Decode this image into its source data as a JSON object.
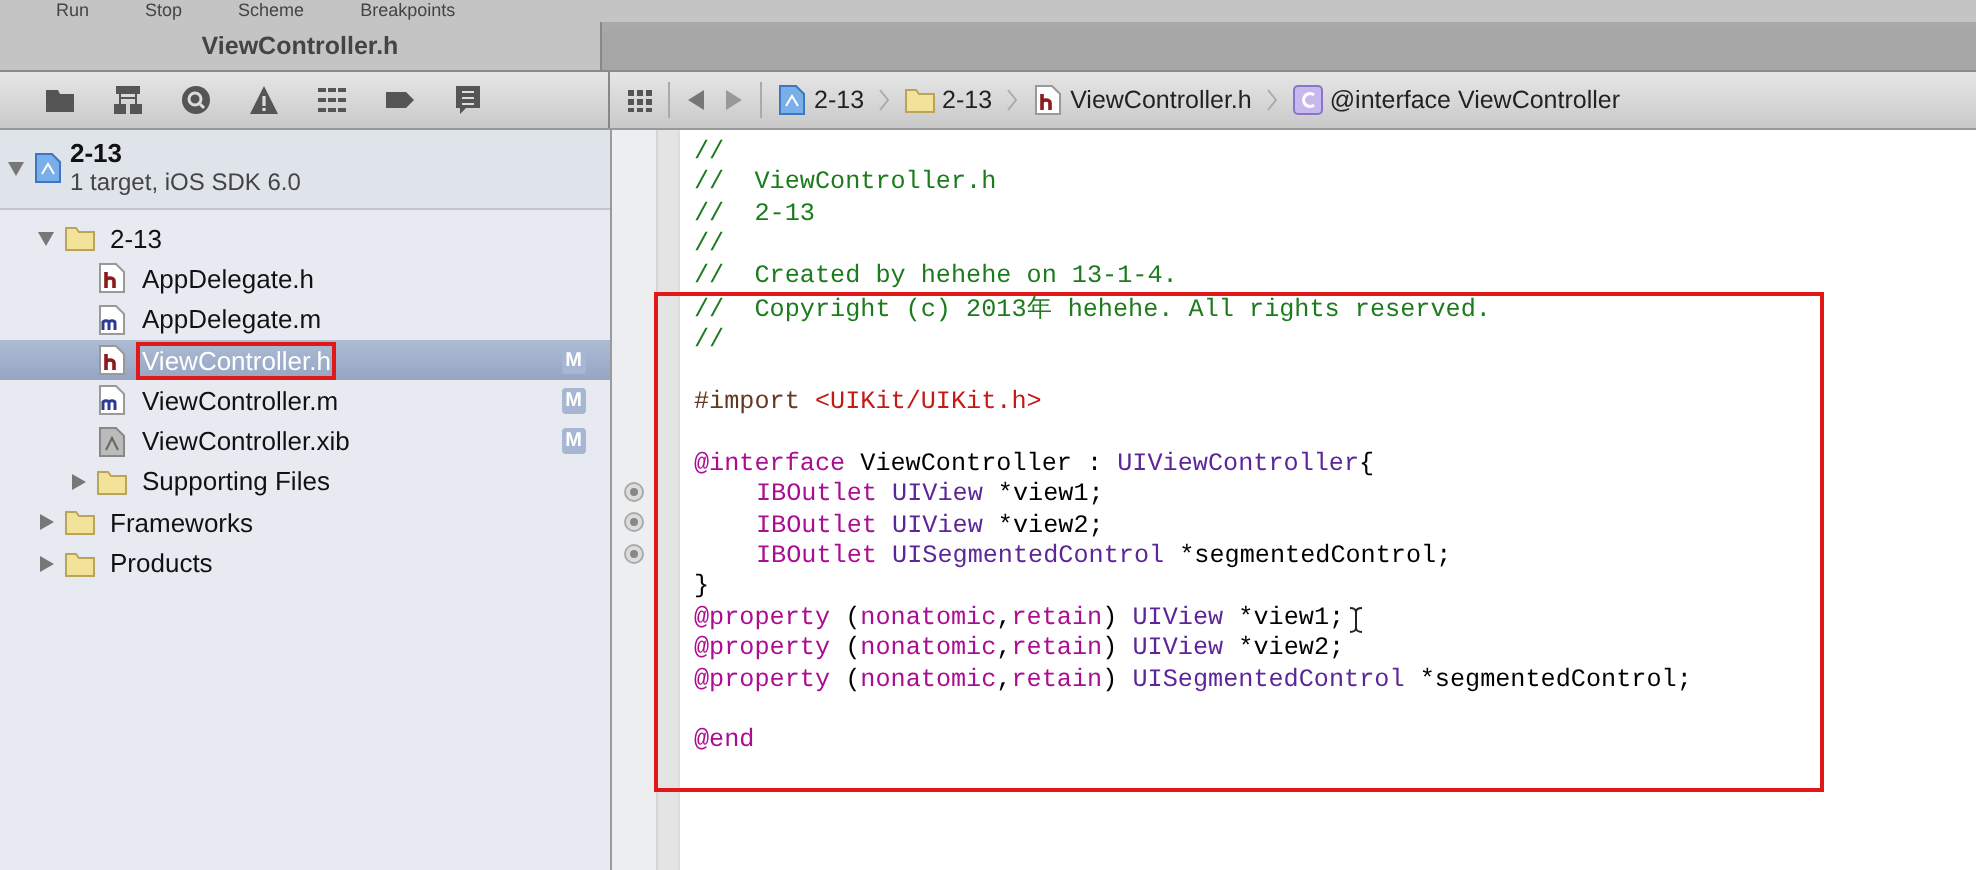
{
  "toolbar": {
    "labels": [
      "Run",
      "Stop",
      "Scheme",
      "Breakpoints"
    ]
  },
  "tabs": [
    {
      "label": "ViewController.h",
      "selected": true
    }
  ],
  "jump_bar": [
    {
      "kind": "project",
      "label": "2-13"
    },
    {
      "kind": "folder",
      "label": "2-13"
    },
    {
      "kind": "header",
      "label": "ViewController.h"
    },
    {
      "kind": "class",
      "label": "@interface ViewController"
    }
  ],
  "project": {
    "name": "2-13",
    "subtitle": "1 target, iOS SDK 6.0",
    "expanded": true,
    "children": [
      {
        "kind": "folder",
        "name": "2-13",
        "expanded": true,
        "selected": false,
        "annotated": false,
        "children": [
          {
            "kind": "header",
            "name": "AppDelegate.h",
            "selected": false,
            "annotated": false
          },
          {
            "kind": "source",
            "name": "AppDelegate.m",
            "selected": false,
            "annotated": false
          },
          {
            "kind": "header",
            "name": "ViewController.h",
            "selected": true,
            "annotated": true,
            "badge": "M"
          },
          {
            "kind": "source",
            "name": "ViewController.m",
            "selected": false,
            "annotated": false,
            "badge": "M"
          },
          {
            "kind": "xib",
            "name": "ViewController.xib",
            "selected": false,
            "annotated": false,
            "badge": "M"
          },
          {
            "kind": "folder",
            "name": "Supporting Files",
            "expanded": false,
            "selected": false,
            "annotated": false
          }
        ]
      },
      {
        "kind": "folder",
        "name": "Frameworks",
        "expanded": false,
        "selected": false,
        "annotated": false
      },
      {
        "kind": "folder",
        "name": "Products",
        "expanded": false,
        "selected": false,
        "annotated": false
      }
    ]
  },
  "code": {
    "lines": [
      {
        "boxed": false,
        "outlet": false,
        "cursor": false,
        "indented": false,
        "tokens": [
          {
            "kind": "comment",
            "text": "//"
          }
        ]
      },
      {
        "boxed": false,
        "outlet": false,
        "cursor": false,
        "indented": false,
        "tokens": [
          {
            "kind": "comment",
            "text": "//  ViewController.h"
          }
        ]
      },
      {
        "boxed": false,
        "outlet": false,
        "cursor": false,
        "indented": false,
        "tokens": [
          {
            "kind": "comment",
            "text": "//  2-13"
          }
        ]
      },
      {
        "boxed": false,
        "outlet": false,
        "cursor": false,
        "indented": false,
        "tokens": [
          {
            "kind": "comment",
            "text": "//"
          }
        ]
      },
      {
        "boxed": false,
        "outlet": false,
        "cursor": false,
        "indented": false,
        "tokens": [
          {
            "kind": "comment",
            "text": "//  Created by hehehe on 13-1-4."
          }
        ]
      },
      {
        "boxed": true,
        "outlet": false,
        "cursor": false,
        "indented": false,
        "tokens": [
          {
            "kind": "comment",
            "text": "//  Copyright (c) 2013年 hehehe. All rights reserved."
          }
        ]
      },
      {
        "boxed": true,
        "outlet": false,
        "cursor": false,
        "indented": false,
        "tokens": [
          {
            "kind": "comment",
            "text": "//"
          }
        ]
      },
      {
        "boxed": true,
        "outlet": false,
        "cursor": false,
        "indented": false
      },
      {
        "boxed": true,
        "outlet": false,
        "cursor": false,
        "indented": false,
        "tokens": [
          {
            "kind": "directive",
            "text": "#import "
          },
          {
            "kind": "string",
            "text": "<UIKit/UIKit.h>"
          }
        ]
      },
      {
        "boxed": true,
        "outlet": false,
        "cursor": false,
        "indented": false
      },
      {
        "boxed": true,
        "outlet": false,
        "cursor": false,
        "indented": false,
        "tokens": [
          {
            "kind": "keyword",
            "text": "@interface"
          },
          {
            "kind": "plain",
            "text": " ViewController : "
          },
          {
            "kind": "type",
            "text": "UIViewController"
          },
          {
            "kind": "plain",
            "text": "{"
          }
        ]
      },
      {
        "boxed": true,
        "outlet": true,
        "cursor": false,
        "indented": true,
        "tokens": [
          {
            "kind": "keyword",
            "text": "IBOutlet"
          },
          {
            "kind": "type",
            "text": " UIView"
          },
          {
            "kind": "plain",
            "text": " *view1;"
          }
        ]
      },
      {
        "boxed": true,
        "outlet": true,
        "cursor": false,
        "indented": true,
        "tokens": [
          {
            "kind": "keyword",
            "text": "IBOutlet"
          },
          {
            "kind": "type",
            "text": " UIView"
          },
          {
            "kind": "plain",
            "text": " *view2;"
          }
        ]
      },
      {
        "boxed": true,
        "outlet": true,
        "cursor": false,
        "indented": true,
        "tokens": [
          {
            "kind": "keyword",
            "text": "IBOutlet"
          },
          {
            "kind": "type",
            "text": " UISegmentedControl"
          },
          {
            "kind": "plain",
            "text": " *segmentedControl;"
          }
        ]
      },
      {
        "boxed": true,
        "outlet": false,
        "cursor": false,
        "indented": false,
        "tokens": [
          {
            "kind": "plain",
            "text": "}"
          }
        ]
      },
      {
        "boxed": true,
        "outlet": false,
        "cursor": true,
        "indented": false,
        "tokens": [
          {
            "kind": "keyword",
            "text": "@property"
          },
          {
            "kind": "plain",
            "text": " ("
          },
          {
            "kind": "keyword",
            "text": "nonatomic"
          },
          {
            "kind": "plain",
            "text": ","
          },
          {
            "kind": "keyword",
            "text": "retain"
          },
          {
            "kind": "plain",
            "text": ") "
          },
          {
            "kind": "type",
            "text": "UIView"
          },
          {
            "kind": "plain",
            "text": " *view1;"
          }
        ]
      },
      {
        "boxed": true,
        "outlet": false,
        "cursor": false,
        "indented": false,
        "tokens": [
          {
            "kind": "keyword",
            "text": "@property"
          },
          {
            "kind": "plain",
            "text": " ("
          },
          {
            "kind": "keyword",
            "text": "nonatomic"
          },
          {
            "kind": "plain",
            "text": ","
          },
          {
            "kind": "keyword",
            "text": "retain"
          },
          {
            "kind": "plain",
            "text": ") "
          },
          {
            "kind": "type",
            "text": "UIView"
          },
          {
            "kind": "plain",
            "text": " *view2;"
          }
        ]
      },
      {
        "boxed": true,
        "outlet": false,
        "cursor": false,
        "indented": false,
        "tokens": [
          {
            "kind": "keyword",
            "text": "@property"
          },
          {
            "kind": "plain",
            "text": " ("
          },
          {
            "kind": "keyword",
            "text": "nonatomic"
          },
          {
            "kind": "plain",
            "text": ","
          },
          {
            "kind": "keyword",
            "text": "retain"
          },
          {
            "kind": "plain",
            "text": ") "
          },
          {
            "kind": "type",
            "text": "UISegmentedControl"
          },
          {
            "kind": "plain",
            "text": " *segmentedControl;"
          }
        ]
      },
      {
        "boxed": true,
        "outlet": false,
        "cursor": false,
        "indented": false
      },
      {
        "boxed": true,
        "outlet": false,
        "cursor": false,
        "indented": false,
        "tokens": [
          {
            "kind": "keyword",
            "text": "@end"
          }
        ]
      },
      {
        "boxed": true,
        "outlet": false,
        "cursor": false,
        "indented": false
      }
    ]
  }
}
